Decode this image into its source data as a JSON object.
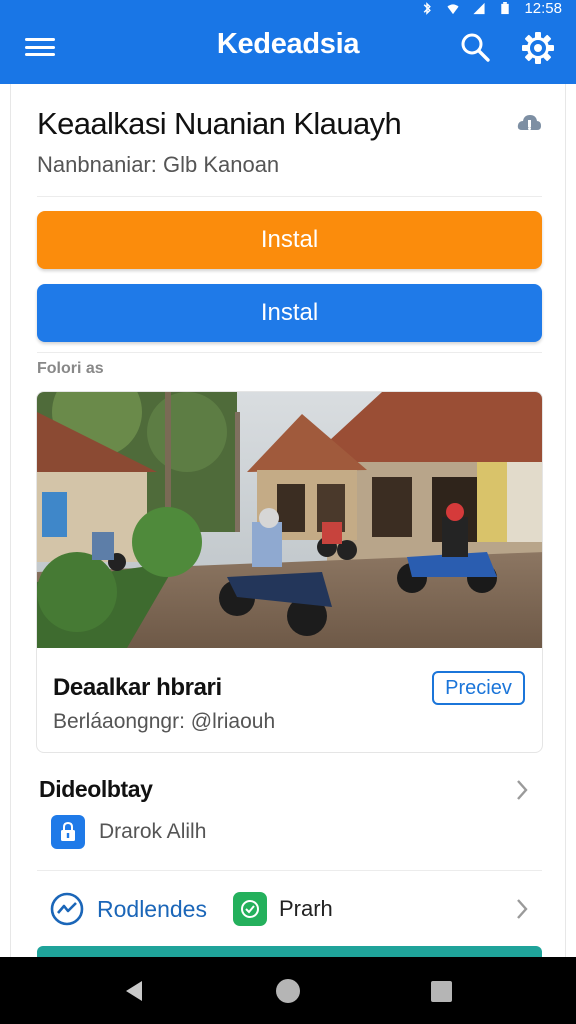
{
  "status_bar": {
    "time": "12:58"
  },
  "app_bar": {
    "title": "Kedeadsia"
  },
  "app_header": {
    "name": "Keaalkasi Nuanian Klauayh",
    "subtitle": "Nanbnaniar: Glb Kanoan"
  },
  "actions": {
    "install_primary": "Instal",
    "install_secondary": "Instal"
  },
  "section": {
    "label": "Folori as"
  },
  "media_card": {
    "title": "Deaalkar hbrari",
    "subtitle": "Berláaongngr: @lriaouh",
    "preview_label": "Preciev"
  },
  "detail_row": {
    "title": "Dideolbtay",
    "item_label": "Drarok Alilh"
  },
  "bottom_row": {
    "stat_label": "Rodlendes",
    "secondary_label": "Prarh"
  },
  "colors": {
    "app_bar": "#1976e6",
    "orange_button": "#fb8c0c",
    "blue_button": "#1f7ae8",
    "link_blue": "#1b75d9",
    "green": "#24b05c",
    "teal": "#1fa39a"
  }
}
